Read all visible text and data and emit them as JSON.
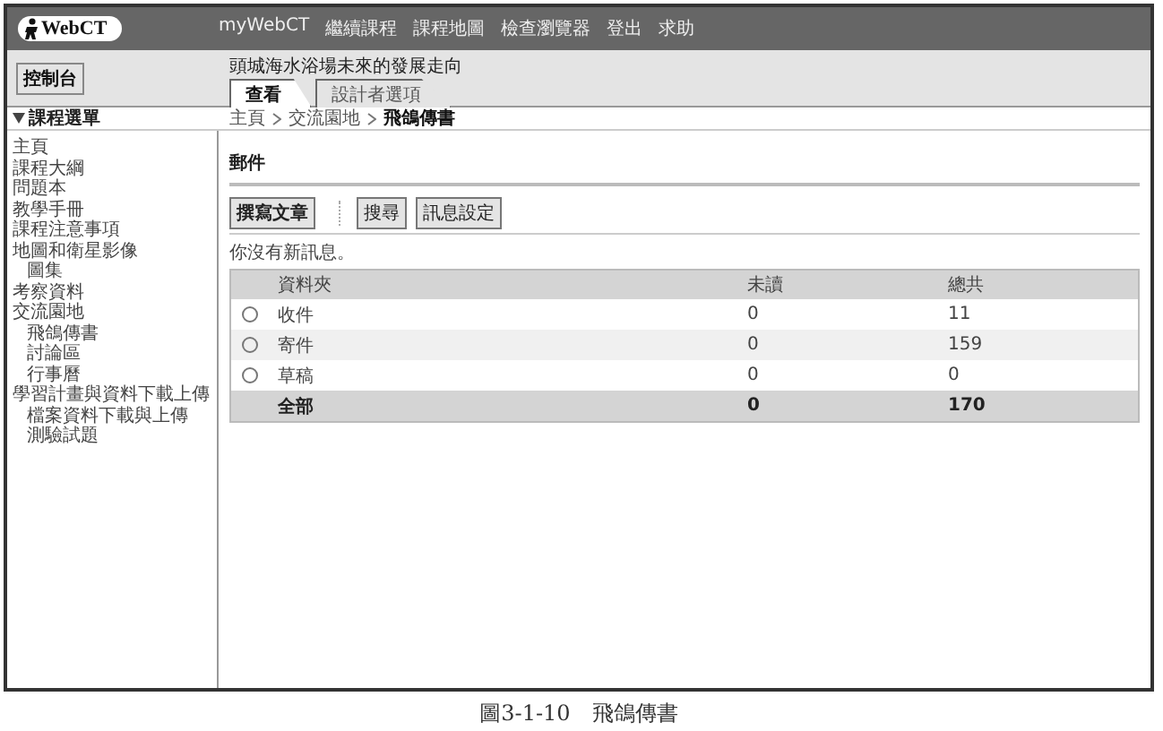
{
  "header": {
    "logo": "WebCT",
    "nav": [
      "myWebCT",
      "繼續課程",
      "課程地圖",
      "檢查瀏覽器",
      "登出",
      "求助"
    ]
  },
  "control_panel": "控制台",
  "course_title": "頭城海水浴場未來的發展走向",
  "tabs": [
    {
      "label": "查看",
      "selected": true
    },
    {
      "label": "設計者選項",
      "selected": false
    }
  ],
  "sidebar": {
    "title": "課程選單",
    "expanded": true,
    "items": [
      {
        "label": "主頁"
      },
      {
        "label": "課程大綱"
      },
      {
        "label": "問題本"
      },
      {
        "label": "教學手冊"
      },
      {
        "label": "課程注意事項"
      },
      {
        "label": "地圖和衛星影像",
        "children": [
          {
            "label": "圖集"
          }
        ]
      },
      {
        "label": "考察資料"
      },
      {
        "label": "交流園地",
        "children": [
          {
            "label": "飛鴿傳書"
          },
          {
            "label": "討論區"
          },
          {
            "label": "行事曆"
          }
        ]
      },
      {
        "label": "學習計畫與資料下載上傳",
        "children": [
          {
            "label": "檔案資料下載與上傳"
          },
          {
            "label": "測驗試題"
          }
        ]
      }
    ]
  },
  "breadcrumb": [
    "主頁",
    "交流園地",
    "飛鴿傳書"
  ],
  "section_title": "郵件",
  "buttons": [
    "撰寫文章",
    "搜尋",
    "訊息設定"
  ],
  "message": "你沒有新訊息。",
  "table": {
    "columns": [
      "資料夾",
      "未讀",
      "總共"
    ],
    "rows": [
      {
        "kind": "folder",
        "selected": false,
        "folder": "收件",
        "unread": "0",
        "total": "11"
      },
      {
        "kind": "folder",
        "selected": false,
        "folder": "寄件",
        "unread": "0",
        "total": "159"
      },
      {
        "kind": "folder",
        "selected": false,
        "folder": "草稿",
        "unread": "0",
        "total": "0"
      },
      {
        "kind": "total",
        "folder": "全部",
        "unread": "0",
        "total": "170"
      }
    ]
  },
  "caption": "圖3-1-10　飛鴿傳書"
}
